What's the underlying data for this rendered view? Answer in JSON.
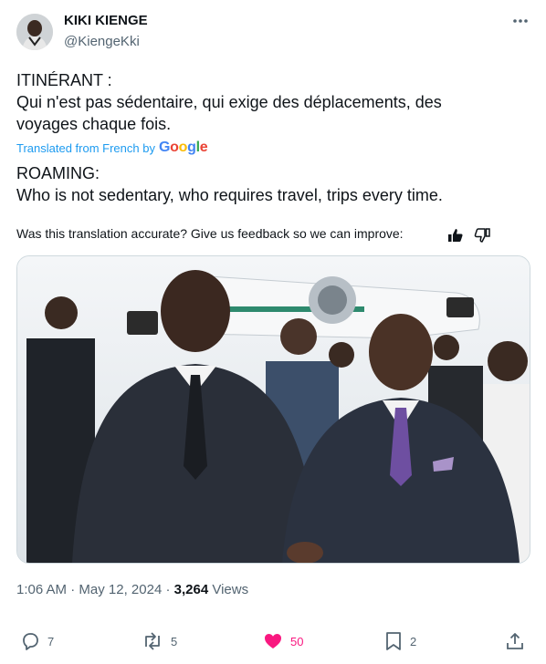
{
  "author": {
    "display_name": "KIKI KIENGE",
    "handle": "@KiengeKki"
  },
  "post": {
    "original_text_line1": "ITINÉRANT :",
    "original_text_line2": "Qui n'est pas sédentaire, qui exige des déplacements, des",
    "original_text_line3": "voyages chaque fois.",
    "translated_label": "Translated from French by",
    "translator_brand": "Google",
    "translation_line1": "ROAMING:",
    "translation_line2": "Who is not sedentary, who requires travel, trips every time.",
    "feedback_prompt": "Was this translation accurate? Give us feedback so we can improve:"
  },
  "meta": {
    "time": "1:06 AM",
    "separator": "·",
    "date": "May 12, 2024",
    "views_count": "3,264",
    "views_label": "Views"
  },
  "actions": {
    "replies": "7",
    "reposts": "5",
    "likes": "50",
    "bookmarks": "2"
  },
  "colors": {
    "like_active": "#f91880",
    "link_blue": "#1d9bf0",
    "secondary_text": "#536471"
  }
}
